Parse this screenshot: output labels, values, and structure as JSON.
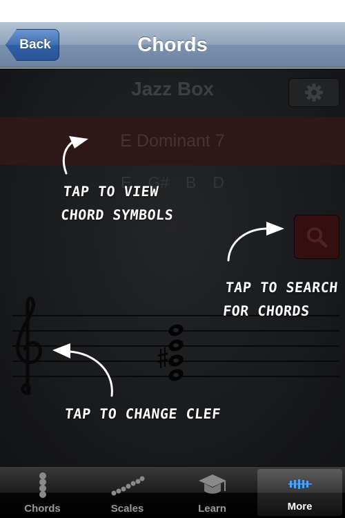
{
  "nav": {
    "back_label": "Back",
    "title": "Chords"
  },
  "instrument": {
    "title": "Jazz Box"
  },
  "chord": {
    "name": "E Dominant 7",
    "notes": [
      "E",
      "G#",
      "B",
      "D"
    ]
  },
  "tips": {
    "symbols_line1": "Tap to view",
    "symbols_line2": "chord symbols",
    "search_line1": "Tap to search",
    "search_line2": "for chords",
    "clef": "Tap to change clef"
  },
  "tabs": [
    {
      "label": "Chords",
      "icon": "chord-dots-icon",
      "active": false
    },
    {
      "label": "Scales",
      "icon": "scale-dots-icon",
      "active": false
    },
    {
      "label": "Learn",
      "icon": "graduation-cap-icon",
      "active": false
    },
    {
      "label": "More",
      "icon": "more-bars-icon",
      "active": true
    }
  ],
  "colors": {
    "nav_bar": "#8fa3bb",
    "back_button": "#3f6fb3",
    "chord_banner": "#3a1d1f",
    "search_button": "#3f1313",
    "tab_active_icon": "#4aa3ff"
  },
  "staff": {
    "clef": "treble-clef",
    "accidental": "sharp"
  }
}
